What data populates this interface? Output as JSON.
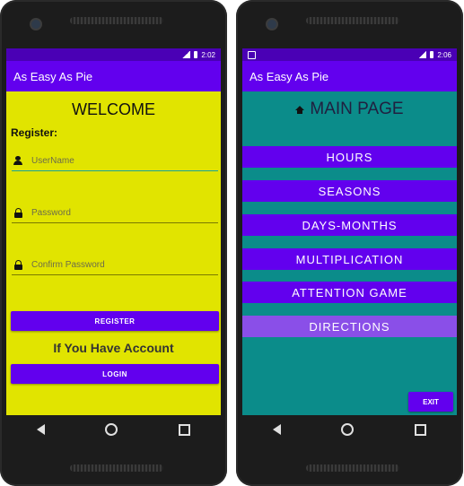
{
  "left": {
    "status_time": "2:02",
    "app_title": "As Easy As Pie",
    "welcome": "WELCOME",
    "register_label": "Register:",
    "username_placeholder": "UserName",
    "password_placeholder": "Password",
    "confirm_placeholder": "Confirm Password",
    "register_button": "REGISTER",
    "have_account": "If You Have Account",
    "login_button": "LOGIN"
  },
  "right": {
    "status_time": "2:06",
    "app_title": "As Easy As Pie",
    "main_title": "MAIN PAGE",
    "menu": [
      "HOURS",
      "SEASONS",
      "DAYS-MONTHS",
      "MULTIPLICATION",
      "ATTENTION GAME",
      "DIRECTIONS"
    ],
    "exit_button": "EXIT"
  },
  "colors": {
    "accent": "#6200ee",
    "status_bar": "#4a00b5",
    "register_bg": "#e1e400",
    "main_bg": "#0b8c8a",
    "highlight": "#8a4fe8"
  }
}
